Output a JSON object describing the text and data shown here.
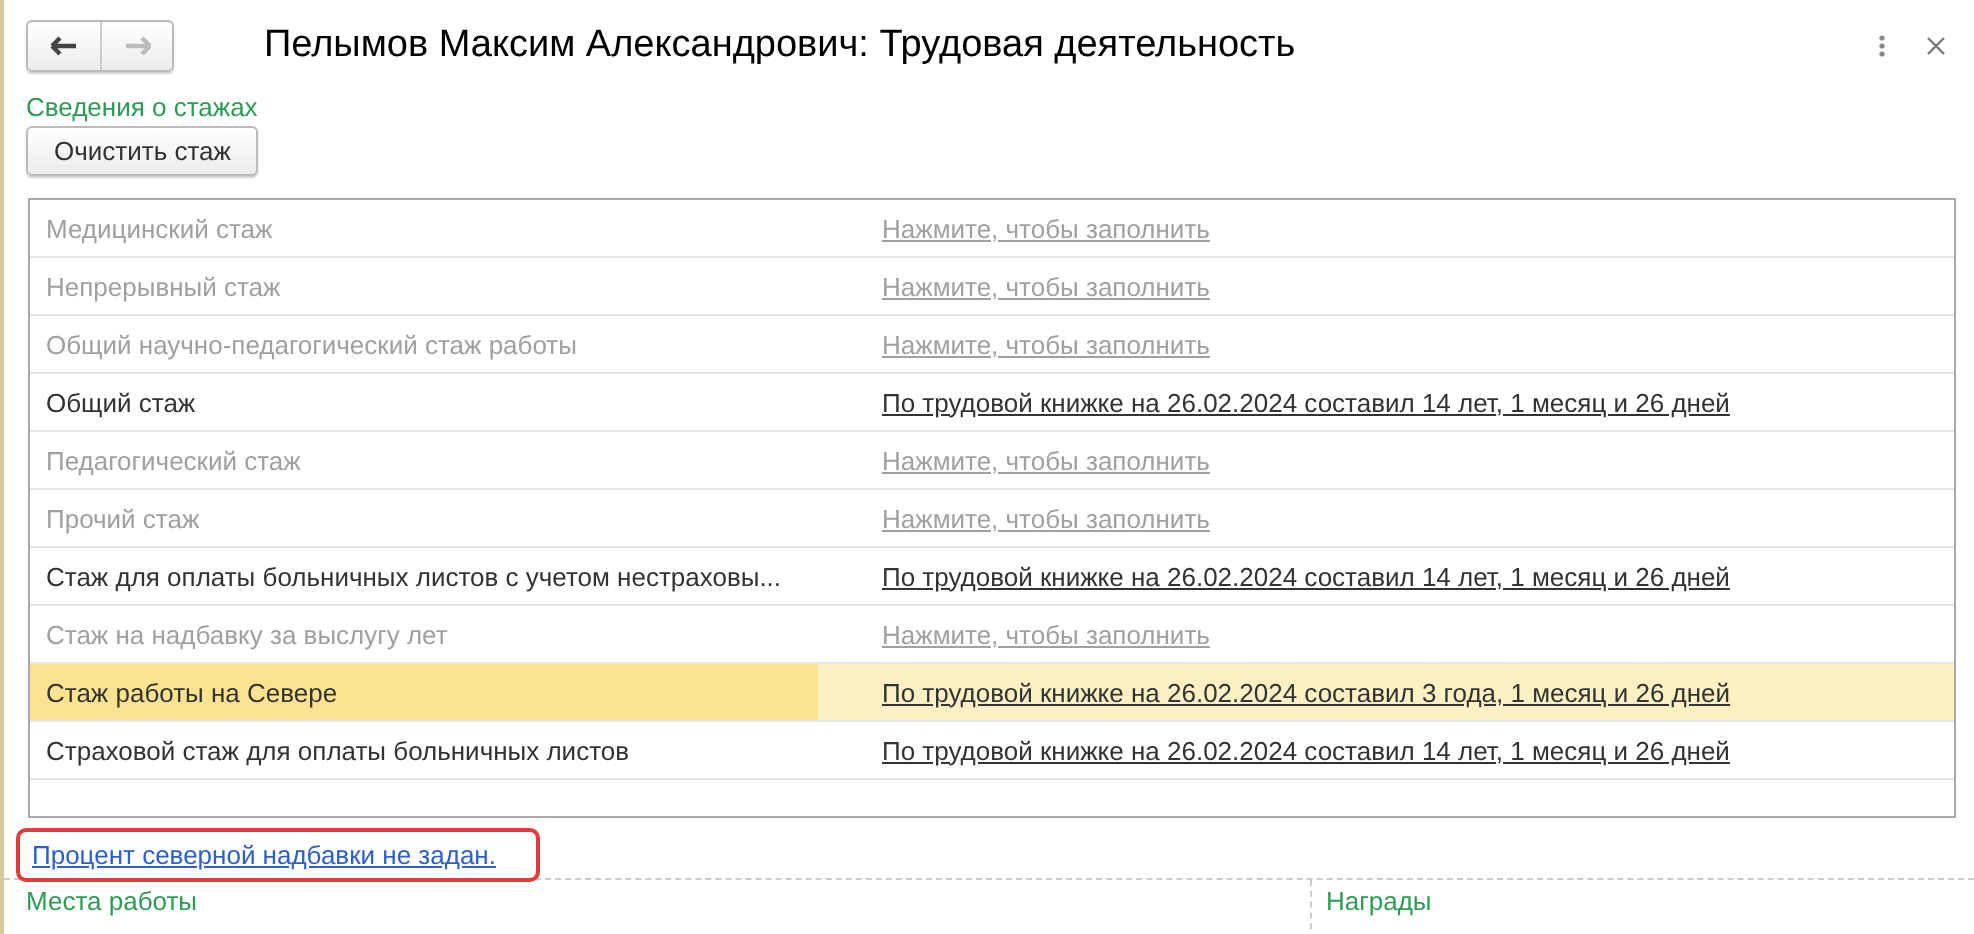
{
  "window": {
    "title": "Пелымов Максим Александрович: Трудовая деятельность",
    "back_enabled": true,
    "forward_enabled": false
  },
  "section_title": "Сведения о стажах",
  "clear_button": "Очистить стаж",
  "rows": [
    {
      "name": "Медицинский стаж",
      "value": "Нажмите, чтобы заполнить",
      "filled": false,
      "selected": false
    },
    {
      "name": "Непрерывный стаж",
      "value": "Нажмите, чтобы заполнить",
      "filled": false,
      "selected": false
    },
    {
      "name": "Общий научно-педагогический стаж работы",
      "value": "Нажмите, чтобы заполнить",
      "filled": false,
      "selected": false
    },
    {
      "name": "Общий стаж",
      "value": "По трудовой книжке на 26.02.2024 составил 14 лет, 1 месяц и 26 дней",
      "filled": true,
      "selected": false
    },
    {
      "name": "Педагогический стаж",
      "value": "Нажмите, чтобы заполнить",
      "filled": false,
      "selected": false
    },
    {
      "name": "Прочий стаж",
      "value": "Нажмите, чтобы заполнить",
      "filled": false,
      "selected": false
    },
    {
      "name": "Стаж для оплаты больничных листов с учетом нестраховы...",
      "value": "По трудовой книжке на 26.02.2024 составил 14 лет, 1 месяц и 26 дней",
      "filled": true,
      "selected": false
    },
    {
      "name": "Стаж на надбавку за выслугу лет",
      "value": "Нажмите, чтобы заполнить",
      "filled": false,
      "selected": false
    },
    {
      "name": "Стаж работы на Севере",
      "value": "По трудовой книжке на 26.02.2024 составил 3 года, 1 месяц и 26 дней",
      "filled": true,
      "selected": true
    },
    {
      "name": "Страховой стаж для оплаты больничных листов",
      "value": "По трудовой книжке на 26.02.2024 составил 14 лет, 1 месяц и 26 дней",
      "filled": true,
      "selected": false
    }
  ],
  "warning_link": {
    "text": "Процент северной надбавки не задан.",
    "highlighted": true
  },
  "bottom_sections": [
    "Места работы",
    "Награды"
  ]
}
